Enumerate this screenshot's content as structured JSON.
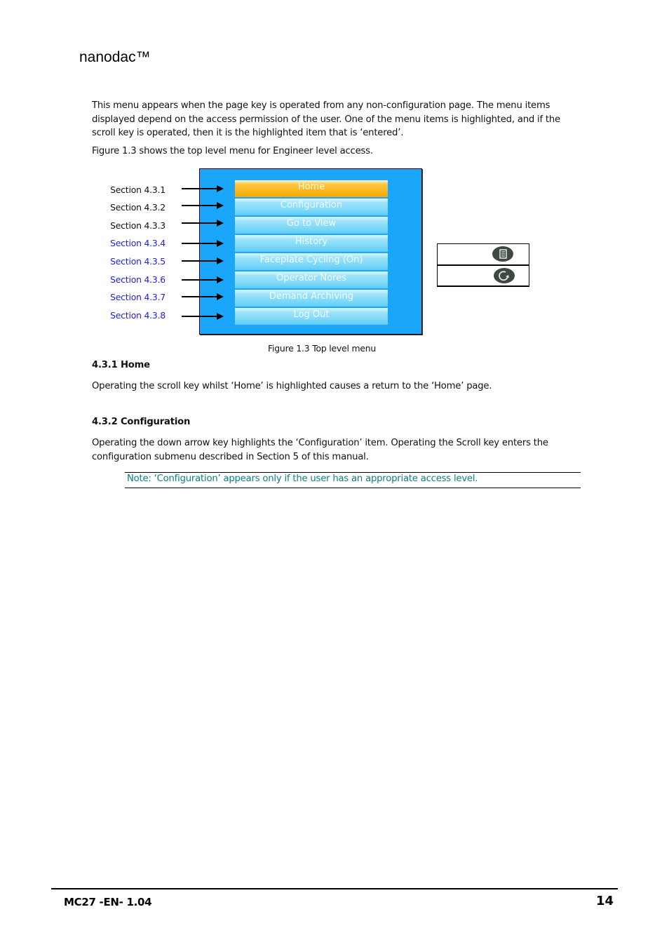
{
  "header": {
    "title": "nanodac™"
  },
  "intro": {
    "paragraph_1": "This menu appears when the page key is operated from any non-configuration page.  The menu items displayed depend on the access permission of the user.  One of the menu items is highlighted, and if the scroll key is operated, then it is the highlighted item that is ‘entered’.",
    "paragraph_2": "Figure 1.3  shows the top level menu for Engineer level access."
  },
  "figure": {
    "caption": "Figure 1.3  Top level menu",
    "colors": {
      "screen_bg": "#1aa6fb",
      "highlight": "#f8b418",
      "item": "#7bd8f8",
      "link_blue": "#2222dd"
    },
    "section_refs": [
      {
        "label": "Section 4.3.1",
        "style": "black"
      },
      {
        "label": "Section 4.3.2",
        "style": "black"
      },
      {
        "label": "Section 4.3.3",
        "style": "black"
      },
      {
        "label": "Section 4.3.4",
        "style": "blue"
      },
      {
        "label": "Section 4.3.5",
        "style": "blue"
      },
      {
        "label": "Section 4.3.6",
        "style": "blue"
      },
      {
        "label": "Section 4.3.7",
        "style": "blue"
      },
      {
        "label": "Section 4.3.8",
        "style": "blue"
      }
    ],
    "menu_items": [
      {
        "label": "Home",
        "highlighted": true
      },
      {
        "label": "Configuration",
        "highlighted": false
      },
      {
        "label": "Go to View",
        "highlighted": false
      },
      {
        "label": "History",
        "highlighted": false
      },
      {
        "label": "Faceplate Cycling (On)",
        "highlighted": false
      },
      {
        "label": "Operator Nores",
        "highlighted": false
      },
      {
        "label": "Demand Archiving",
        "highlighted": false
      },
      {
        "label": "Log Out",
        "highlighted": false
      }
    ],
    "keys": [
      {
        "icon": "page-key-icon"
      },
      {
        "icon": "scroll-key-icon"
      }
    ]
  },
  "sections": [
    {
      "heading": "4.3.1 Home",
      "body": "Operating the scroll key whilst ‘Home’ is highlighted causes a return to the ‘Home’ page."
    },
    {
      "heading": "4.3.2 Configuration",
      "body": "Operating the down arrow key highlights the ‘Configuration’ item.  Operating the Scroll key enters the configuration submenu described in Section 5 of this manual.",
      "note": "Note:  ‘Configuration’ appears only if the user has an appropriate  access level."
    }
  ],
  "footer": {
    "doc_id": "MC27 -EN- 1.04",
    "page_number": "14"
  }
}
